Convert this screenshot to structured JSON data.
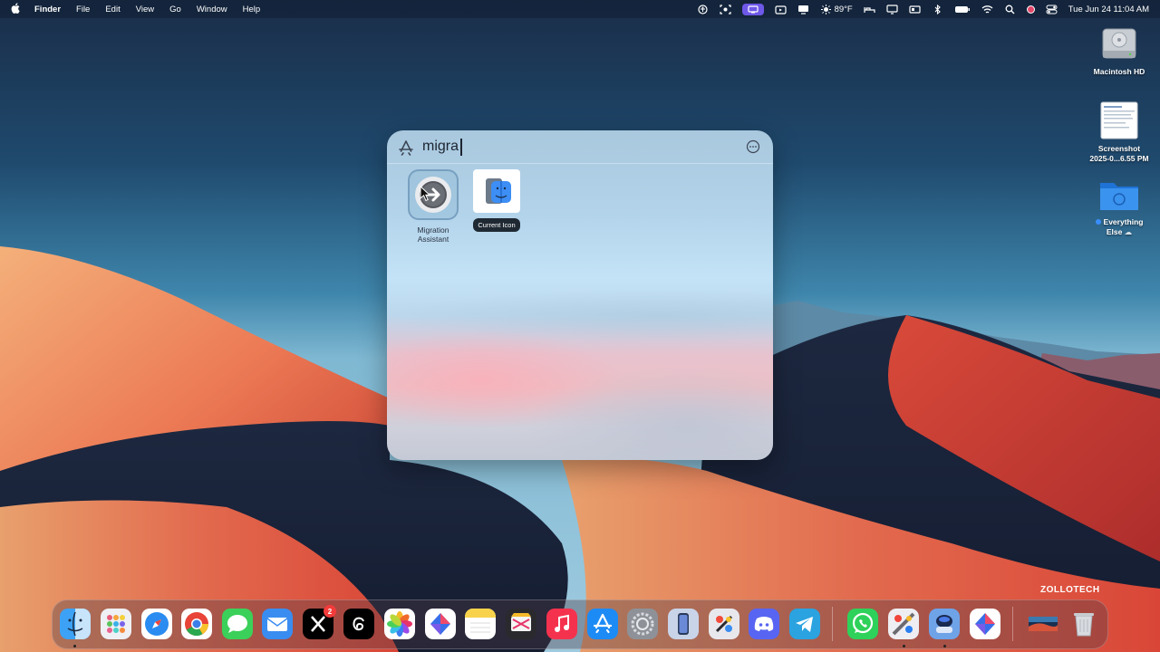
{
  "menubar": {
    "apple_glyph": "",
    "app_name": "Finder",
    "menus": [
      "File",
      "Edit",
      "View",
      "Go",
      "Window",
      "Help"
    ],
    "status_icons": [
      "accessibility-icon",
      "screenshot-icon",
      "screen-mirror-icon",
      "camera-icon",
      "display-icon",
      "weather-icon",
      "bed-icon",
      "display-icon-2",
      "mirror-icon",
      "bluetooth-icon",
      "battery-icon",
      "wifi-icon",
      "search-icon",
      "user-icon",
      "control-center-icon"
    ],
    "weather": "89°F",
    "datetime": "Tue Jun 24  11:04 AM"
  },
  "desktop": {
    "items": [
      {
        "label": "Macintosh HD",
        "icon": "hard-drive-icon"
      },
      {
        "label_line1": "Screenshot",
        "label_line2": "2025-0...6.55 PM",
        "icon": "screenshot-file-icon"
      },
      {
        "label_line1": "Everything",
        "label_line2": "Else",
        "icon": "folder-icon",
        "tag_color": "#3a8dff"
      }
    ]
  },
  "spotlight": {
    "query": "migra",
    "scope_icon": "app-store-icon",
    "more_icon": "ellipsis-circle-icon",
    "results": [
      {
        "name_line1": "Migration",
        "name_line2": "Assistant",
        "icon": "migration-assistant-icon",
        "selected": true
      },
      {
        "name": "Current Icon",
        "icon": "finder-icon",
        "badge": true
      }
    ]
  },
  "watermark": "ZOLLOTECH",
  "dock": {
    "apps": [
      "finder-icon",
      "launchpad-icon",
      "safari-icon",
      "chrome-icon",
      "messages-icon",
      "mail-icon",
      "x-icon",
      "threads-icon",
      "photos-icon",
      "craft-icon",
      "notes-icon",
      "final-cut-icon",
      "music-icon",
      "app-store-icon",
      "system-settings-icon",
      "iphone-mirroring-icon",
      "pixelmator-icon",
      "discord-icon",
      "telegram-icon",
      "whatsapp-icon",
      "photo-booth-icon",
      "migration-dock-icon",
      "craft-icon-2",
      "downloads-stack-icon",
      "trash-icon"
    ],
    "x_badge": "2"
  }
}
